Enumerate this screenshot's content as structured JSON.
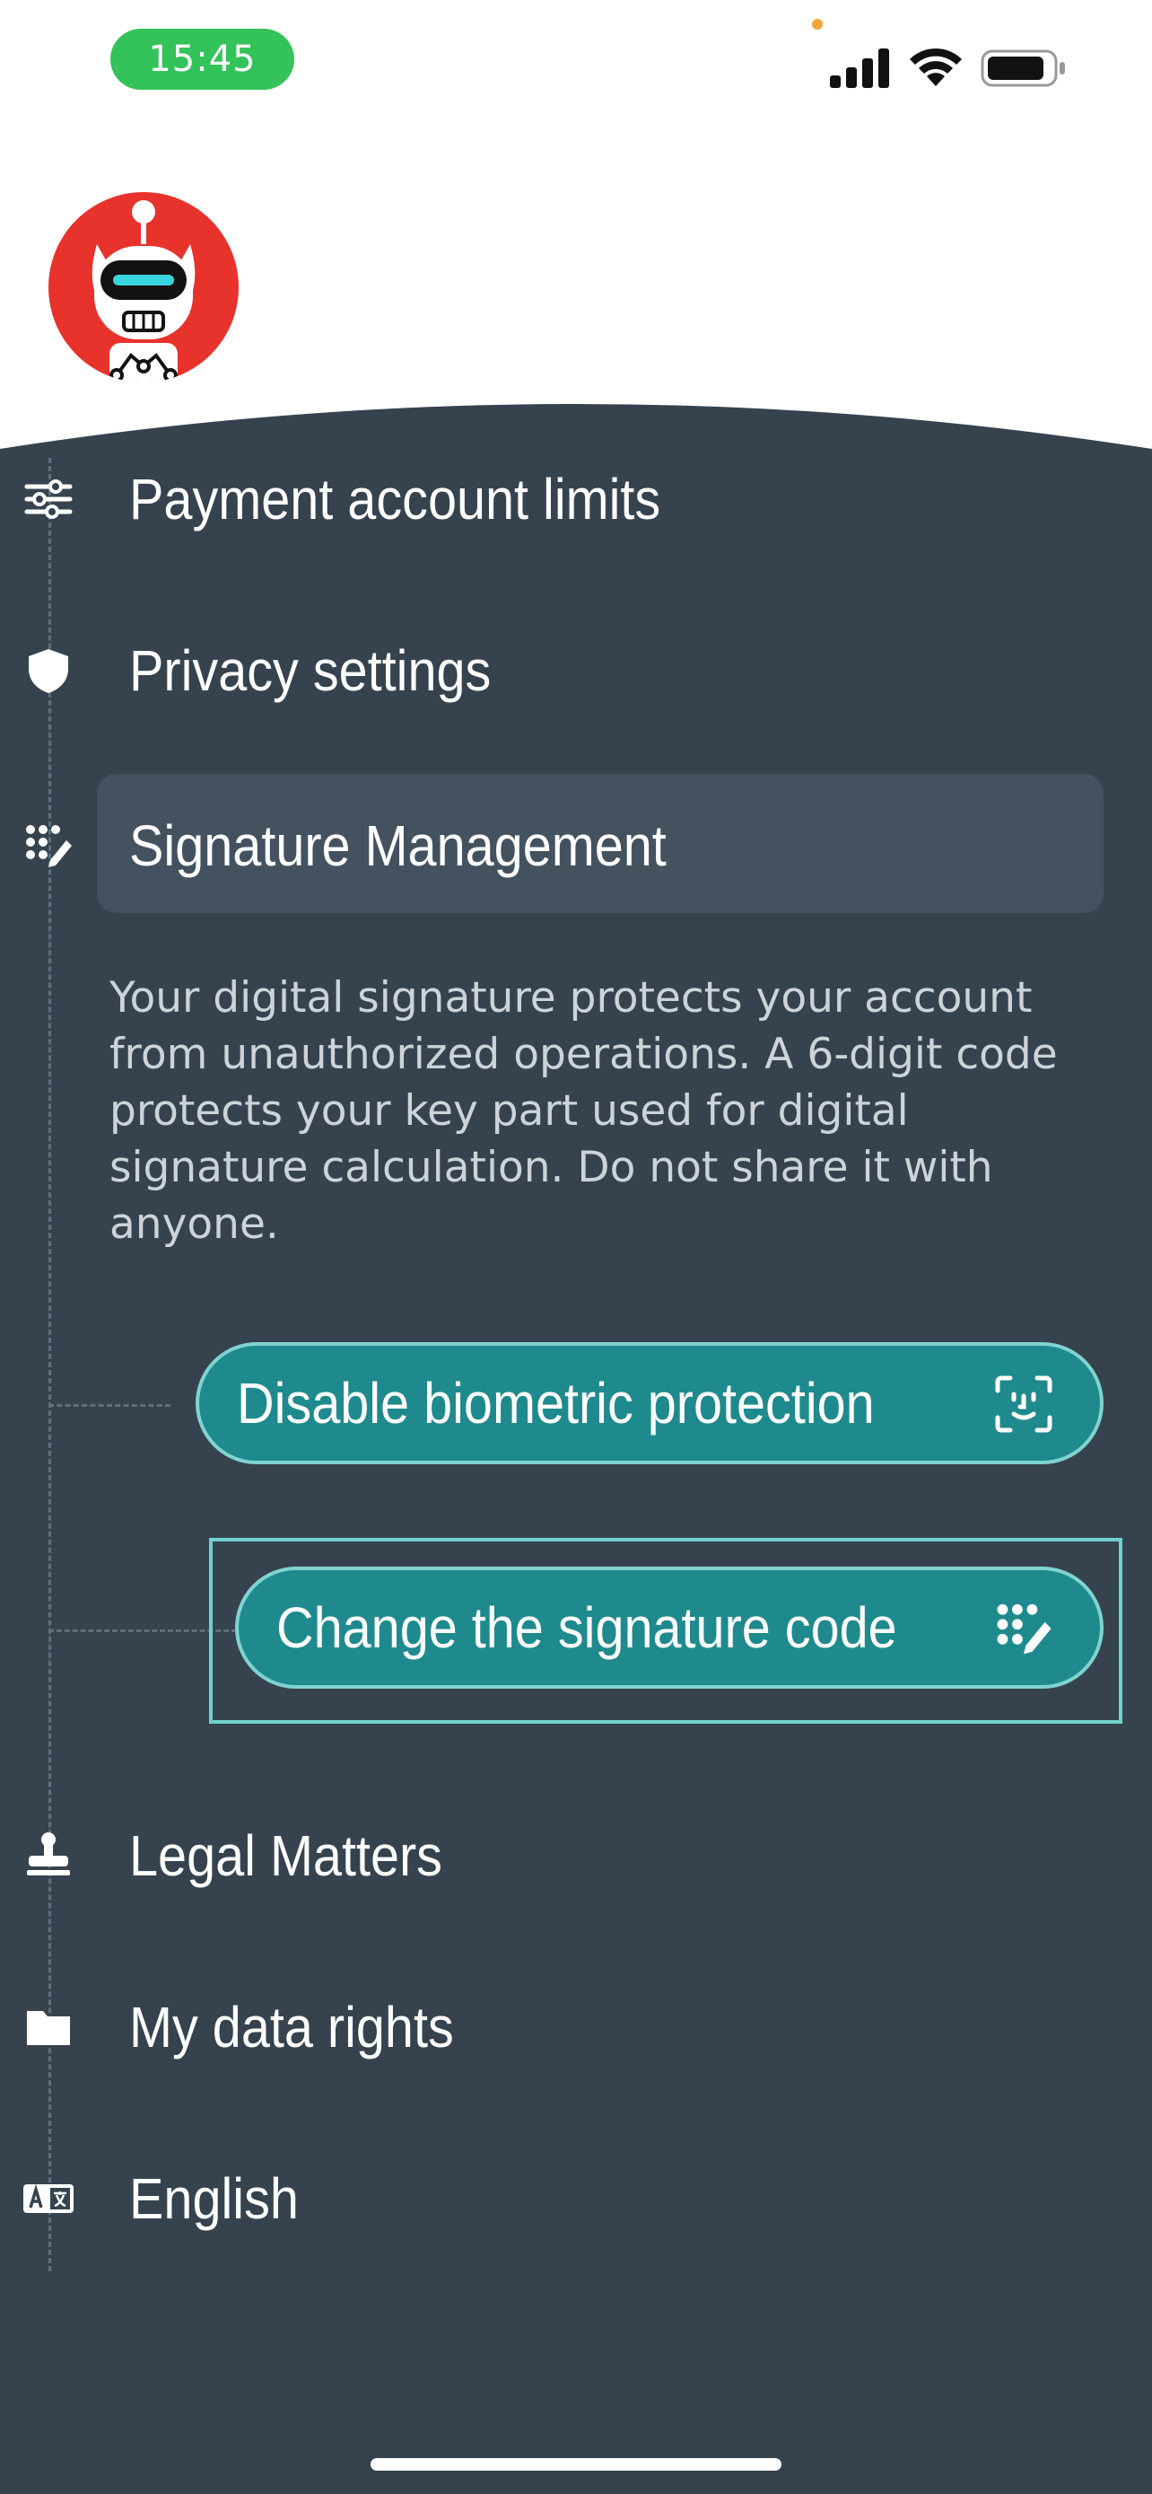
{
  "status_bar": {
    "time": "15:45",
    "battery_icon": "battery-icon",
    "wifi_icon": "wifi-icon",
    "signal_icon": "cellular-signal-icon"
  },
  "logo": {
    "icon": "robot-mascot-logo"
  },
  "colors": {
    "panel_background": "#36434f",
    "active_item_background": "#445260",
    "button_background": "#1f8a8d",
    "button_border": "#7fd4d0",
    "status_pill": "#34c25a"
  },
  "menu": {
    "items": [
      {
        "label": "Payment account limits",
        "icon": "sliders-icon"
      },
      {
        "label": "Privacy settings",
        "icon": "shield-icon"
      },
      {
        "label": "Signature Management",
        "icon": "keypad-pen-icon",
        "active": true
      },
      {
        "label": "Legal Matters",
        "icon": "stamp-icon"
      },
      {
        "label": "My data rights",
        "icon": "folder-icon"
      },
      {
        "label": "English",
        "icon": "language-icon"
      }
    ]
  },
  "signature": {
    "description": "Your digital signature protects your account from unauthorized operations. A 6-digit code protects your key part used for digital signature calculation. Do not share it with anyone.",
    "disable_biometric_label": "Disable biometric protection",
    "disable_biometric_icon": "face-id-icon",
    "change_code_label": "Change the signature code",
    "change_code_icon": "keypad-pen-icon"
  }
}
